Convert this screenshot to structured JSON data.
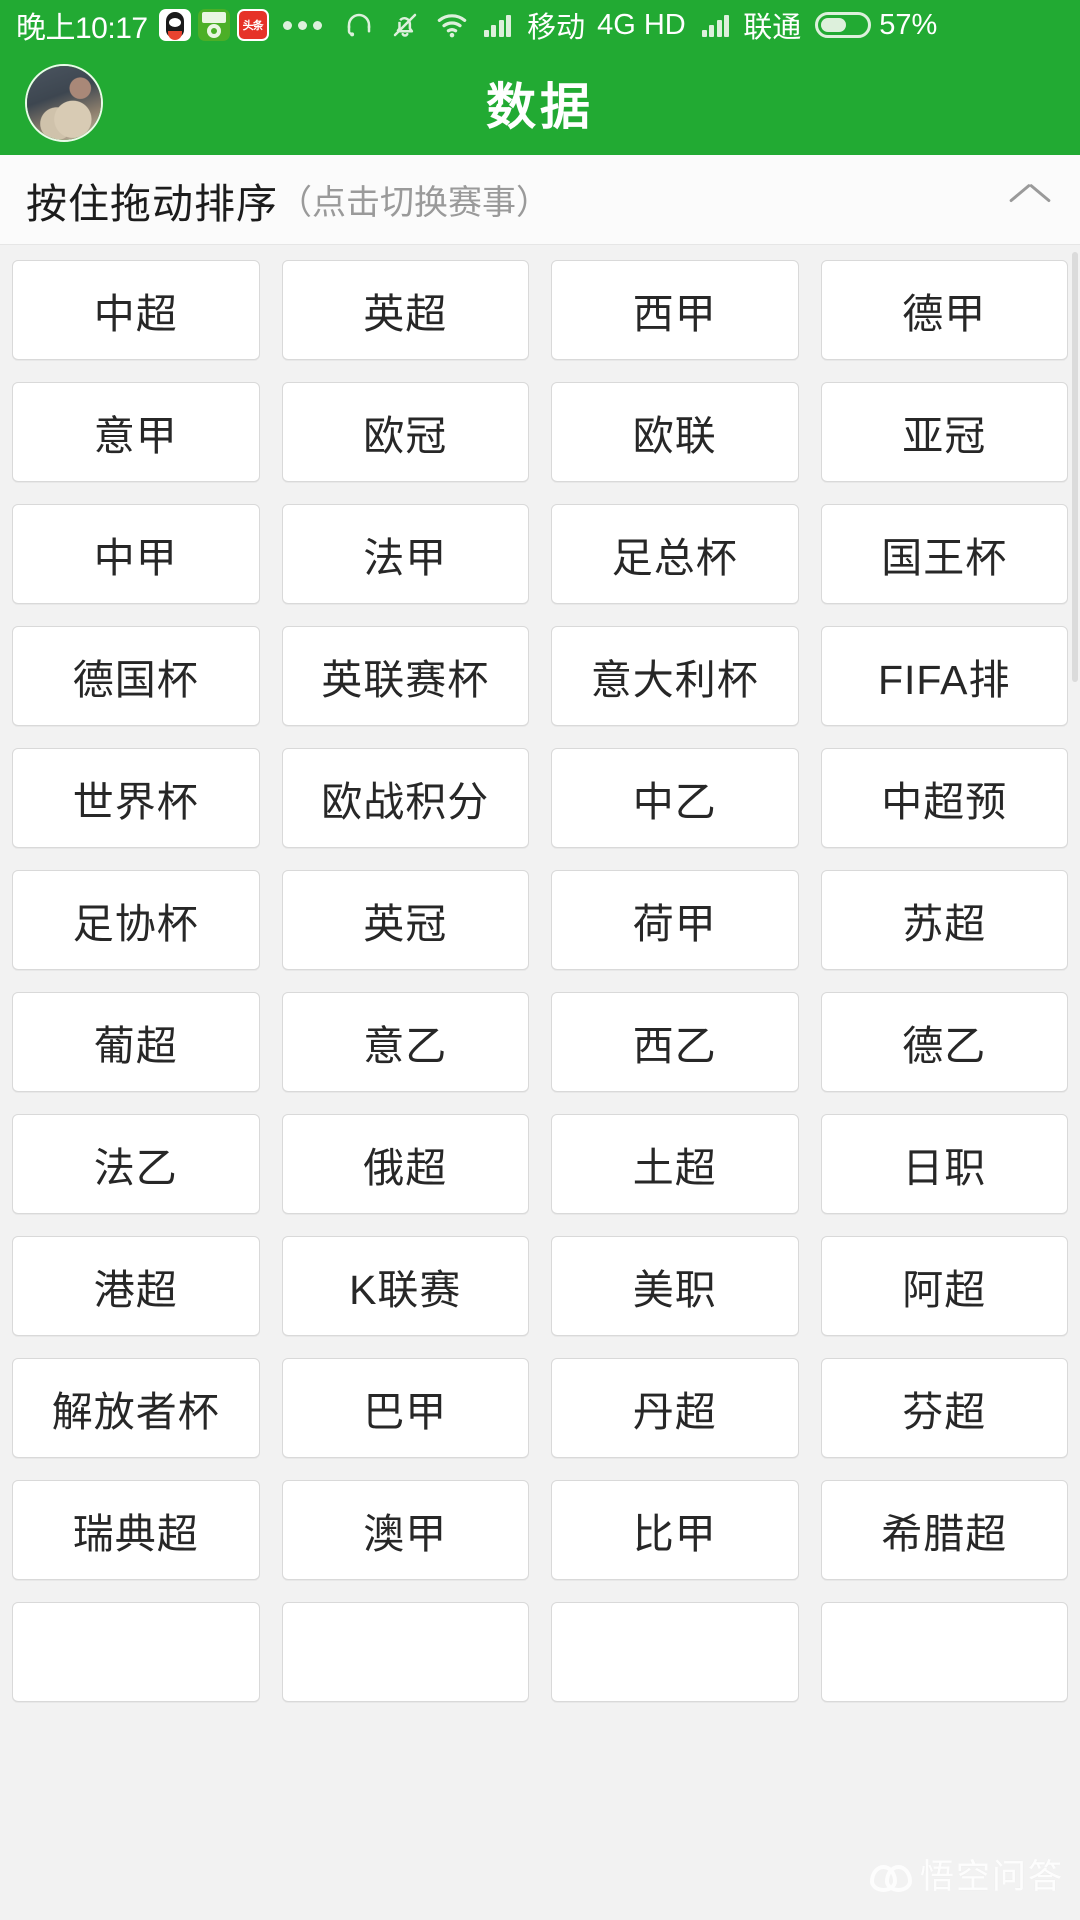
{
  "status_bar": {
    "time": "晚上10:17",
    "app_icons": [
      "qq-icon",
      "green-app-icon",
      "toutiao-icon"
    ],
    "overflow": "more-apps-dots",
    "icons": [
      "headset-icon",
      "bell-muted-icon",
      "wifi-icon",
      "signal-bars-icon"
    ],
    "carrier_1": "移动",
    "network": "4G HD",
    "carrier_2": "联通",
    "battery_percent": "57%",
    "battery_level": 57
  },
  "header": {
    "title": "数据",
    "avatar": "user-avatar"
  },
  "sort_bar": {
    "main_label": "按住拖动排序",
    "sub_label": "（点击切换赛事）",
    "collapse_icon": "chevron-up-icon"
  },
  "grid": {
    "items": [
      "中超",
      "英超",
      "西甲",
      "德甲",
      "意甲",
      "欧冠",
      "欧联",
      "亚冠",
      "中甲",
      "法甲",
      "足总杯",
      "国王杯",
      "德国杯",
      "英联赛杯",
      "意大利杯",
      "FIFA排",
      "世界杯",
      "欧战积分",
      "中乙",
      "中超预",
      "足协杯",
      "英冠",
      "荷甲",
      "苏超",
      "葡超",
      "意乙",
      "西乙",
      "德乙",
      "法乙",
      "俄超",
      "土超",
      "日职",
      "港超",
      "K联赛",
      "美职",
      "阿超",
      "解放者杯",
      "巴甲",
      "丹超",
      "芬超",
      "瑞典超",
      "澳甲",
      "比甲",
      "希腊超",
      "",
      "",
      "",
      ""
    ]
  },
  "watermark": {
    "text": "悟空问答"
  },
  "colors": {
    "brand_green": "#22aa33",
    "page_background": "#f2f2f2",
    "tile_background": "#ffffff",
    "tile_border": "#d9d9d9",
    "tile_text": "#272727",
    "sub_label_gray": "#9a9a9a"
  }
}
